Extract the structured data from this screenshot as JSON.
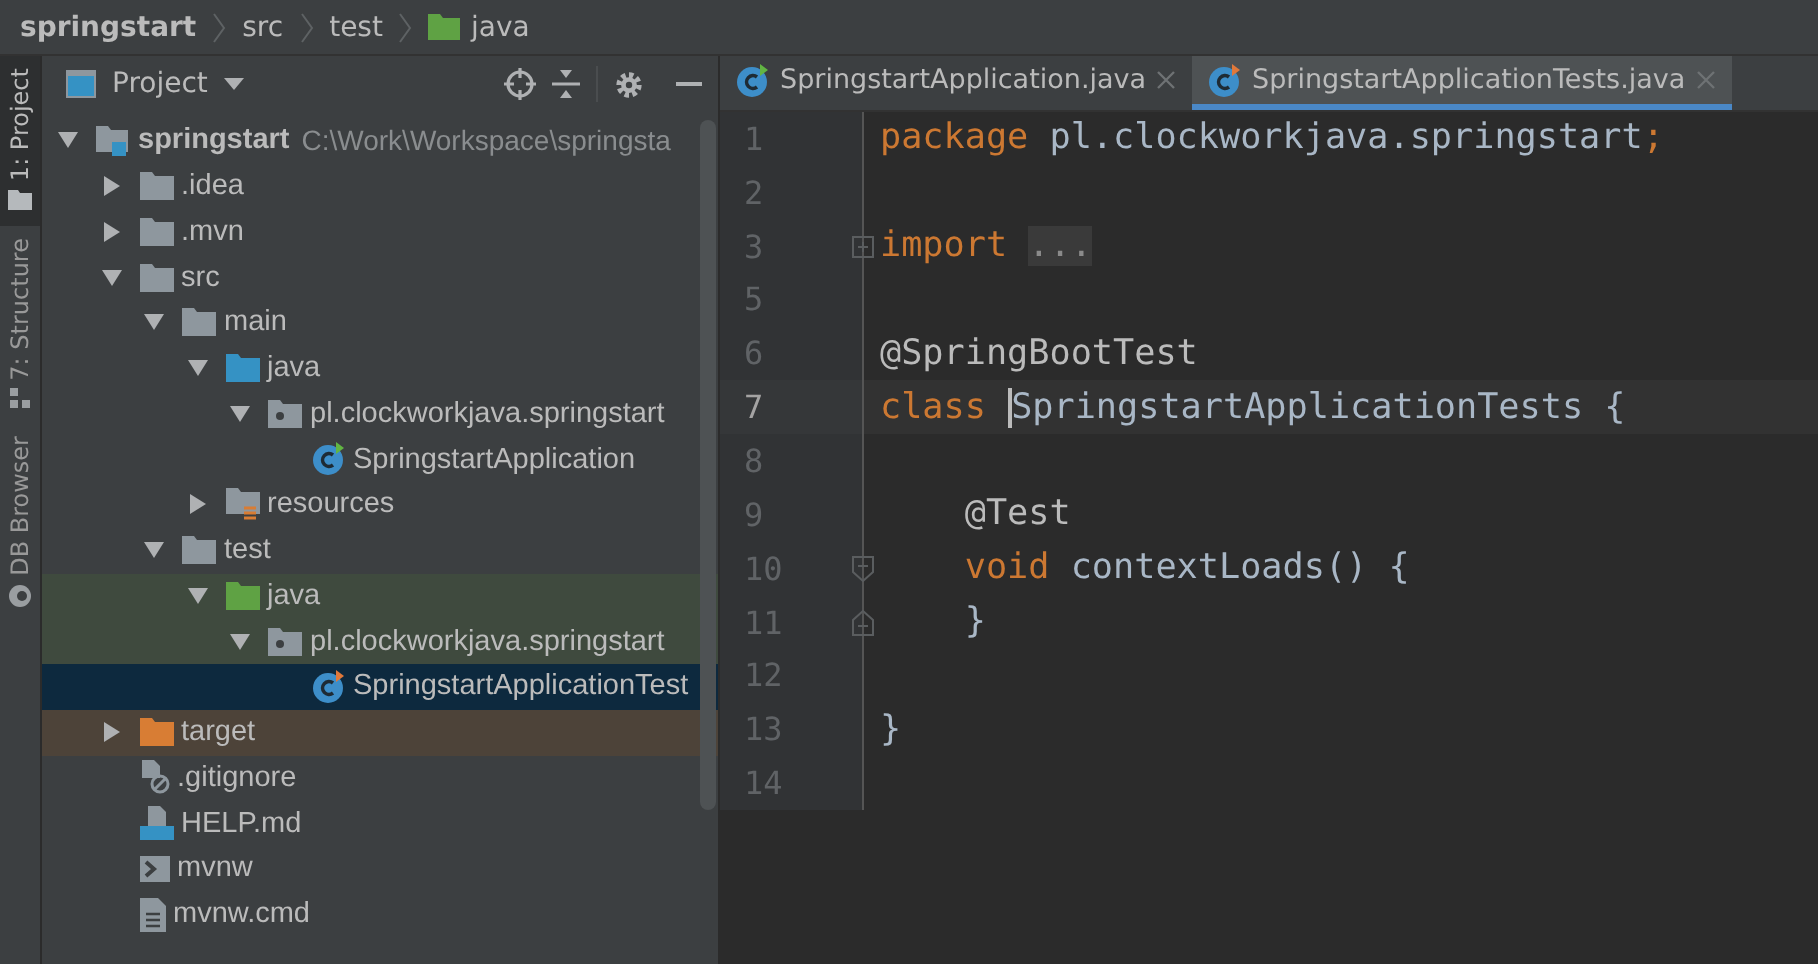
{
  "breadcrumb": [
    {
      "label": "springstart",
      "kind": "project"
    },
    {
      "label": "src",
      "kind": "folder"
    },
    {
      "label": "test",
      "kind": "folder"
    },
    {
      "label": "java",
      "kind": "test-folder"
    }
  ],
  "side_tabs": [
    {
      "label": "1: Project",
      "kind": "project",
      "selected": true
    },
    {
      "label": "7: Structure",
      "kind": "structure",
      "selected": false
    },
    {
      "label": "DB Browser",
      "kind": "database",
      "selected": false
    }
  ],
  "project_panel": {
    "title": "Project",
    "tree": [
      {
        "name": "springstart",
        "path": "C:\\Work\\Workspace\\springsta",
        "kind": "module",
        "expanded": true,
        "selected": false,
        "children": [
          {
            "name": ".idea",
            "kind": "folder",
            "expanded": false,
            "selected": false
          },
          {
            "name": ".mvn",
            "kind": "folder",
            "expanded": false,
            "selected": false
          },
          {
            "name": "src",
            "kind": "folder",
            "expanded": true,
            "selected": false,
            "children": [
              {
                "name": "main",
                "kind": "folder",
                "expanded": true,
                "selected": false,
                "children": [
                  {
                    "name": "java",
                    "kind": "source-folder",
                    "expanded": true,
                    "selected": false,
                    "children": [
                      {
                        "name": "pl.clockworkjava.springstart",
                        "kind": "package",
                        "expanded": true,
                        "selected": false,
                        "children": [
                          {
                            "name": "SpringstartApplication",
                            "kind": "class",
                            "selected": false
                          }
                        ]
                      }
                    ]
                  },
                  {
                    "name": "resources",
                    "kind": "resource-folder",
                    "expanded": false,
                    "selected": false
                  }
                ]
              },
              {
                "name": "test",
                "kind": "folder",
                "expanded": true,
                "selected": false,
                "children": [
                  {
                    "name": "java",
                    "kind": "test-folder",
                    "color": "#3f4a3e",
                    "expanded": true,
                    "selected": false,
                    "children": [
                      {
                        "name": "pl.clockworkjava.springstart",
                        "kind": "package",
                        "color": "#3f4a3e",
                        "expanded": true,
                        "selected": false,
                        "children": [
                          {
                            "name": "SpringstartApplicationTest",
                            "kind": "class",
                            "selected": true
                          }
                        ]
                      }
                    ]
                  }
                ]
              }
            ]
          },
          {
            "name": "target",
            "kind": "excluded-folder",
            "color": "#4d4339",
            "expanded": false,
            "selected": false
          },
          {
            "name": ".gitignore",
            "kind": "ignore-file",
            "selected": false
          },
          {
            "name": "HELP.md",
            "kind": "markdown-file",
            "selected": false
          },
          {
            "name": "mvnw",
            "kind": "script-file",
            "selected": false
          },
          {
            "name": "mvnw.cmd",
            "kind": "text-file",
            "selected": false
          }
        ]
      }
    ]
  },
  "editor": {
    "tabs": [
      {
        "label": "SpringstartApplication.java",
        "selected": false
      },
      {
        "label": "SpringstartApplicationTests.java",
        "selected": true
      }
    ],
    "lines": [
      {
        "number": "1",
        "kind": "plain",
        "tokens": [
          {
            "kind": "keyword",
            "text": "package"
          },
          {
            "kind": "plain",
            "text": " pl.clockworkjava.springstart"
          },
          {
            "kind": "keyword",
            "text": ";"
          }
        ]
      },
      {
        "number": "2",
        "kind": "plain"
      },
      {
        "number": "3",
        "kind": "fold-collapsed",
        "tokens": [
          {
            "kind": "keyword",
            "text": "import "
          },
          {
            "kind": "folded",
            "text": "..."
          }
        ]
      },
      {
        "number": "5",
        "kind": "plain"
      },
      {
        "number": "6",
        "kind": "plain",
        "tokens": [
          {
            "kind": "annotation",
            "text": "@SpringBootTest"
          }
        ]
      },
      {
        "number": "7",
        "kind": "plain",
        "current": true,
        "tokens": [
          {
            "kind": "keyword",
            "text": "class "
          },
          {
            "kind": "plain",
            "text": "SpringstartApplicationTests {",
            "caret": true
          }
        ]
      },
      {
        "number": "8",
        "kind": "plain"
      },
      {
        "number": "9",
        "kind": "plain",
        "tokens": [
          {
            "kind": "annotation",
            "text": "    @Test"
          }
        ]
      },
      {
        "number": "10",
        "kind": "fold-start",
        "tokens": [
          {
            "kind": "keyword",
            "text": "    void "
          },
          {
            "kind": "plain",
            "text": "contextLoads() {"
          }
        ]
      },
      {
        "number": "11",
        "kind": "fold-end",
        "tokens": [
          {
            "kind": "plain",
            "text": "    }"
          }
        ]
      },
      {
        "number": "12",
        "kind": "plain"
      },
      {
        "number": "13",
        "kind": "plain",
        "tokens": [
          {
            "kind": "plain",
            "text": "}"
          }
        ]
      },
      {
        "number": "14",
        "kind": "plain"
      }
    ]
  }
}
